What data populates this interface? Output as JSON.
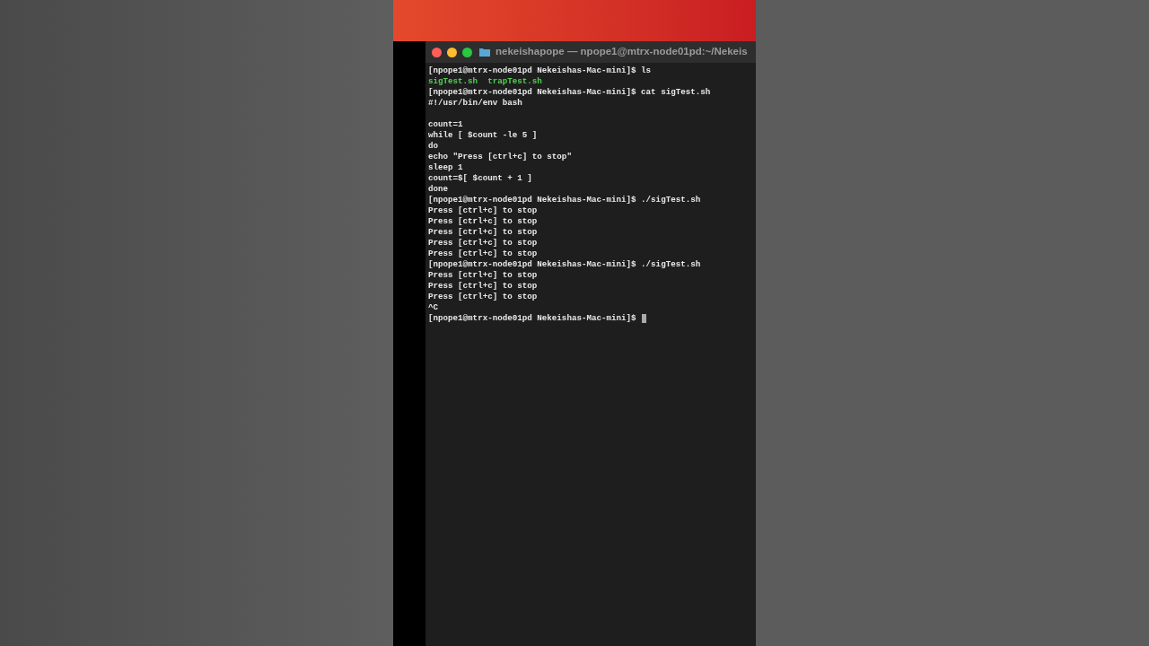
{
  "window": {
    "title": "nekeishapope — npope1@mtrx-node01pd:~/Nekeis"
  },
  "terminal": {
    "lines": [
      {
        "kind": "prompt",
        "text": "[npope1@mtrx-node01pd Nekeishas-Mac-mini]$ ls"
      },
      {
        "kind": "file",
        "text": "sigTest.sh  trapTest.sh"
      },
      {
        "kind": "prompt",
        "text": "[npope1@mtrx-node01pd Nekeishas-Mac-mini]$ cat sigTest.sh"
      },
      {
        "kind": "output",
        "text": "#!/usr/bin/env bash"
      },
      {
        "kind": "blank"
      },
      {
        "kind": "output",
        "text": "count=1"
      },
      {
        "kind": "output",
        "text": "while [ $count -le 5 ]"
      },
      {
        "kind": "output",
        "text": "do"
      },
      {
        "kind": "output",
        "text": "echo \"Press [ctrl+c] to stop\""
      },
      {
        "kind": "output",
        "text": "sleep 1"
      },
      {
        "kind": "output",
        "text": "count=$[ $count + 1 ]"
      },
      {
        "kind": "output",
        "text": "done"
      },
      {
        "kind": "prompt",
        "text": "[npope1@mtrx-node01pd Nekeishas-Mac-mini]$ ./sigTest.sh"
      },
      {
        "kind": "output",
        "text": "Press [ctrl+c] to stop"
      },
      {
        "kind": "output",
        "text": "Press [ctrl+c] to stop"
      },
      {
        "kind": "output",
        "text": "Press [ctrl+c] to stop"
      },
      {
        "kind": "output",
        "text": "Press [ctrl+c] to stop"
      },
      {
        "kind": "output",
        "text": "Press [ctrl+c] to stop"
      },
      {
        "kind": "prompt",
        "text": "[npope1@mtrx-node01pd Nekeishas-Mac-mini]$ ./sigTest.sh"
      },
      {
        "kind": "output",
        "text": "Press [ctrl+c] to stop"
      },
      {
        "kind": "output",
        "text": "Press [ctrl+c] to stop"
      },
      {
        "kind": "output",
        "text": "Press [ctrl+c] to stop"
      },
      {
        "kind": "output",
        "text": "^C"
      },
      {
        "kind": "prompt",
        "text": "[npope1@mtrx-node01pd Nekeishas-Mac-mini]$"
      }
    ],
    "cursor": {
      "visible": true
    }
  }
}
